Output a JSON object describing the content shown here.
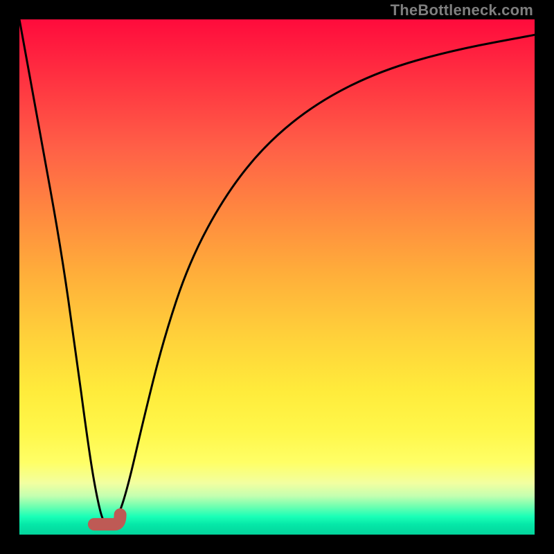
{
  "watermark": "TheBottleneck.com",
  "chart_data": {
    "type": "line",
    "title": "",
    "xlabel": "",
    "ylabel": "",
    "xlim": [
      0,
      100
    ],
    "ylim": [
      0,
      100
    ],
    "grid": false,
    "legend": false,
    "background_gradient": {
      "orientation": "vertical",
      "stops": [
        {
          "pos": 0.0,
          "color": "#ff0b3c"
        },
        {
          "pos": 0.5,
          "color": "#ffb03a"
        },
        {
          "pos": 0.8,
          "color": "#fff74a"
        },
        {
          "pos": 0.93,
          "color": "#c4ffb0"
        },
        {
          "pos": 1.0,
          "color": "#03d49c"
        }
      ]
    },
    "series": [
      {
        "name": "bottleneck-curve",
        "x": [
          0,
          4,
          8,
          11,
          13,
          14.5,
          16,
          17,
          18,
          19,
          21,
          24,
          28,
          33,
          40,
          48,
          58,
          70,
          84,
          100
        ],
        "y": [
          100,
          78,
          56,
          35,
          20,
          10,
          3,
          2,
          2,
          3,
          9,
          22,
          38,
          53,
          66,
          76,
          84,
          90,
          94,
          97
        ]
      }
    ],
    "highlight": {
      "name": "optimal-region-marker",
      "color": "#be5a55",
      "x_range": [
        14.5,
        18.5
      ],
      "y": 2
    }
  }
}
